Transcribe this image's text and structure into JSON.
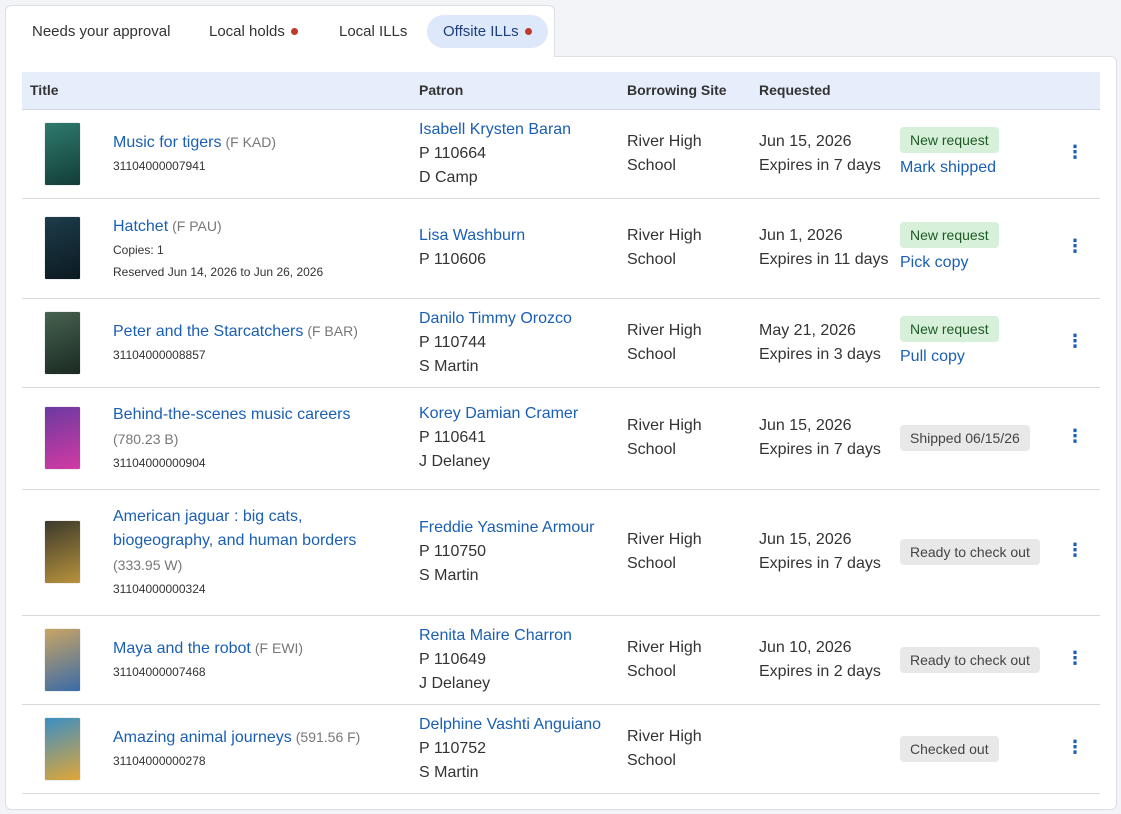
{
  "tabs": [
    {
      "label": "Needs your approval"
    },
    {
      "label": "Local holds"
    },
    {
      "label": "Local ILLs"
    },
    {
      "label": "Offsite ILLs"
    }
  ],
  "columns": {
    "title": "Title",
    "patron": "Patron",
    "site": "Borrowing Site",
    "requested": "Requested"
  },
  "rows": [
    {
      "title": "Music for tigers",
      "call": "(F KAD)",
      "meta": [
        "31104000007941"
      ],
      "patron": "Isabell Krysten Baran",
      "patron_id": "P 110664",
      "teacher": "D Camp",
      "site_line1": "River High",
      "site_line2": "School",
      "date": "Jun 15, 2026",
      "expires": "Expires in 7 days",
      "status": "New request",
      "action": "Mark shipped"
    },
    {
      "title": "Hatchet",
      "call": "(F PAU)",
      "meta": [
        "Copies: 1",
        "Reserved Jun 14, 2026 to Jun 26, 2026"
      ],
      "patron": "Lisa Washburn",
      "patron_id": "P 110606",
      "teacher": "",
      "site_line1": "River High",
      "site_line2": "School",
      "date": "Jun 1, 2026",
      "expires": "Expires in 11 days",
      "status": "New request",
      "action": "Pick copy"
    },
    {
      "title": "Peter and the Starcatchers",
      "call": "(F BAR)",
      "meta": [
        "31104000008857"
      ],
      "patron": "Danilo Timmy Orozco",
      "patron_id": "P 110744",
      "teacher": "S Martin",
      "site_line1": "River High",
      "site_line2": "School",
      "date": "May 21, 2026",
      "expires": "Expires in 3 days",
      "status": "New request",
      "action": "Pull copy"
    },
    {
      "title": "Behind-the-scenes music careers",
      "call": "(780.23 B)",
      "meta": [
        "31104000000904"
      ],
      "patron": "Korey Damian Cramer",
      "patron_id": "P 110641",
      "teacher": "J Delaney",
      "site_line1": "River High",
      "site_line2": "School",
      "date": "Jun 15, 2026",
      "expires": "Expires in 7 days",
      "status": "Shipped 06/15/26",
      "action": ""
    },
    {
      "title": "American jaguar : big cats, biogeography, and human borders",
      "call": "(333.95 W)",
      "meta": [
        "31104000000324"
      ],
      "patron": "Freddie Yasmine Armour",
      "patron_id": "P 110750",
      "teacher": "S Martin",
      "site_line1": "River High",
      "site_line2": "School",
      "date": "Jun 15, 2026",
      "expires": "Expires in 7 days",
      "status": "Ready to check out",
      "action": ""
    },
    {
      "title": "Maya and the robot",
      "call": "(F EWI)",
      "meta": [
        "31104000007468"
      ],
      "patron": "Renita Maire Charron",
      "patron_id": "P 110649",
      "teacher": "J Delaney",
      "site_line1": "River High",
      "site_line2": "School",
      "date": "Jun 10, 2026",
      "expires": "Expires in 2 days",
      "status": "Ready to check out",
      "action": ""
    },
    {
      "title": "Amazing animal journeys",
      "call": "(591.56 F)",
      "meta": [
        "31104000000278"
      ],
      "patron": "Delphine Vashti Anguiano",
      "patron_id": "P 110752",
      "teacher": "S Martin",
      "site_line1": "River High",
      "site_line2": "School",
      "date": "",
      "expires": "",
      "status": "Checked out",
      "action": ""
    }
  ],
  "colors": {
    "accent": "#1a5fb4",
    "active_tab_bg": "#dde8fb",
    "header_bg": "#e6eefb",
    "dot": "#c0392b",
    "badge_green": "#d7f0d9",
    "badge_grey": "#e8e8e8"
  }
}
